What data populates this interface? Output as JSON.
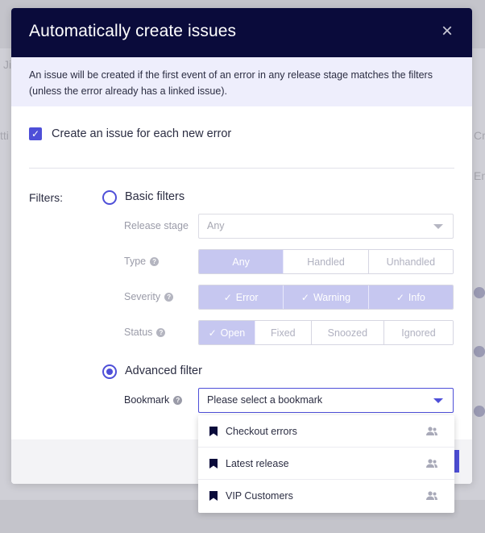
{
  "background": {
    "fragments": [
      "Ji",
      "tti",
      "Cr",
      "En"
    ]
  },
  "modal": {
    "title": "Automatically create issues",
    "close_glyph": "×",
    "info": "An issue will be created if the first event of an error in any release stage matches the filters (unless the error already has a linked issue).",
    "create_issue": {
      "label": "Create an issue for each new error",
      "checked": true
    },
    "filters_label": "Filters:",
    "basic_filters": {
      "label": "Basic filters",
      "selected": false,
      "release_stage": {
        "label": "Release stage",
        "value": "Any"
      },
      "type": {
        "label": "Type",
        "help": "?",
        "options": [
          "Any",
          "Handled",
          "Unhandled"
        ],
        "active": [
          true,
          false,
          false
        ]
      },
      "severity": {
        "label": "Severity",
        "help": "?",
        "options": [
          "Error",
          "Warning",
          "Info"
        ],
        "active": [
          true,
          true,
          true
        ]
      },
      "status": {
        "label": "Status",
        "help": "?",
        "options": [
          "Open",
          "Fixed",
          "Snoozed",
          "Ignored"
        ],
        "active": [
          true,
          false,
          false,
          false
        ]
      },
      "tick_glyph": "✓"
    },
    "advanced_filter": {
      "label": "Advanced filter",
      "selected": true,
      "bookmark": {
        "label": "Bookmark",
        "help": "?",
        "placeholder": "Please select a bookmark"
      }
    }
  },
  "dropdown": {
    "items": [
      {
        "label": "Checkout errors",
        "icon": "bookmark-icon",
        "shared_icon": "people-icon"
      },
      {
        "label": "Latest release",
        "icon": "bookmark-icon",
        "shared_icon": "people-icon"
      },
      {
        "label": "VIP Customers",
        "icon": "bookmark-icon",
        "shared_icon": "people-icon"
      }
    ]
  },
  "colors": {
    "header_bg": "#0a0b3b",
    "accent": "#4e4fd8",
    "info_bg": "#eeeefc",
    "segment_on": "#c6c7f0"
  }
}
